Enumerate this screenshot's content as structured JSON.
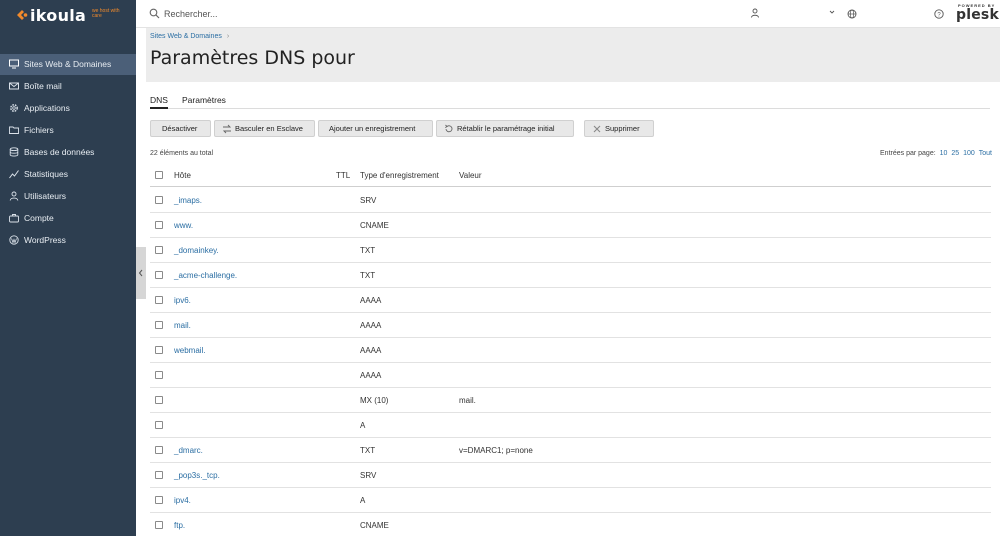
{
  "header": {
    "logo_text": "ikoula",
    "logo_tagline": "we host with care",
    "search_placeholder": "Rechercher...",
    "powered_by": "POWERED BY",
    "plesk": "plesk"
  },
  "colors": {
    "sidebar_bg": "#2d3e50",
    "sidebar_active": "#4b5f78",
    "accent_orange": "#f08a2c",
    "link": "#2b6ea3"
  },
  "sidebar": {
    "items": [
      {
        "label": "Sites Web & Domaines",
        "icon": "monitor-icon",
        "active": true
      },
      {
        "label": "Boîte mail",
        "icon": "mail-icon",
        "active": false
      },
      {
        "label": "Applications",
        "icon": "gear-icon",
        "active": false
      },
      {
        "label": "Fichiers",
        "icon": "folder-icon",
        "active": false
      },
      {
        "label": "Bases de données",
        "icon": "database-icon",
        "active": false
      },
      {
        "label": "Statistiques",
        "icon": "stats-icon",
        "active": false
      },
      {
        "label": "Utilisateurs",
        "icon": "user-icon",
        "active": false
      },
      {
        "label": "Compte",
        "icon": "account-icon",
        "active": false
      },
      {
        "label": "WordPress",
        "icon": "wordpress-icon",
        "active": false
      }
    ]
  },
  "breadcrumb": {
    "item": "Sites Web & Domaines",
    "sep": "›"
  },
  "page": {
    "title": "Paramètres DNS pour"
  },
  "tabs": [
    {
      "label": "DNS",
      "active": true
    },
    {
      "label": "Paramètres",
      "active": false
    }
  ],
  "toolbar": {
    "deactivate": "Désactiver",
    "switch_slave": "Basculer en Esclave",
    "add_record": "Ajouter un enregistrement",
    "restore_default": "Rétablir le paramétrage initial",
    "delete": "Supprimer"
  },
  "list": {
    "count": "22 éléments au total",
    "per_page_label": "Entrées par page:",
    "per_page_options": [
      "10",
      "25",
      "100",
      "Tout"
    ]
  },
  "table": {
    "columns": {
      "host": "Hôte",
      "ttl": "TTL",
      "type": "Type d'enregistrement",
      "value": "Valeur"
    },
    "rows": [
      {
        "host": "_imaps.",
        "ttl": "",
        "type": "SRV",
        "value": ""
      },
      {
        "host": "www.",
        "ttl": "",
        "type": "CNAME",
        "value": ""
      },
      {
        "host": "_domainkey.",
        "ttl": "",
        "type": "TXT",
        "value": ""
      },
      {
        "host": "_acme-challenge.",
        "ttl": "",
        "type": "TXT",
        "value": ""
      },
      {
        "host": "ipv6.",
        "ttl": "",
        "type": "AAAA",
        "value": ""
      },
      {
        "host": "mail.",
        "ttl": "",
        "type": "AAAA",
        "value": ""
      },
      {
        "host": "webmail.",
        "ttl": "",
        "type": "AAAA",
        "value": ""
      },
      {
        "host": "",
        "ttl": "",
        "type": "AAAA",
        "value": ""
      },
      {
        "host": "",
        "ttl": "",
        "type": "MX (10)",
        "value": "mail."
      },
      {
        "host": "",
        "ttl": "",
        "type": "A",
        "value": ""
      },
      {
        "host": "_dmarc.",
        "ttl": "",
        "type": "TXT",
        "value": "v=DMARC1; p=none"
      },
      {
        "host": "_pop3s._tcp.",
        "ttl": "",
        "type": "SRV",
        "value": ""
      },
      {
        "host": "ipv4.",
        "ttl": "",
        "type": "A",
        "value": ""
      },
      {
        "host": "ftp.",
        "ttl": "",
        "type": "CNAME",
        "value": ""
      }
    ]
  }
}
